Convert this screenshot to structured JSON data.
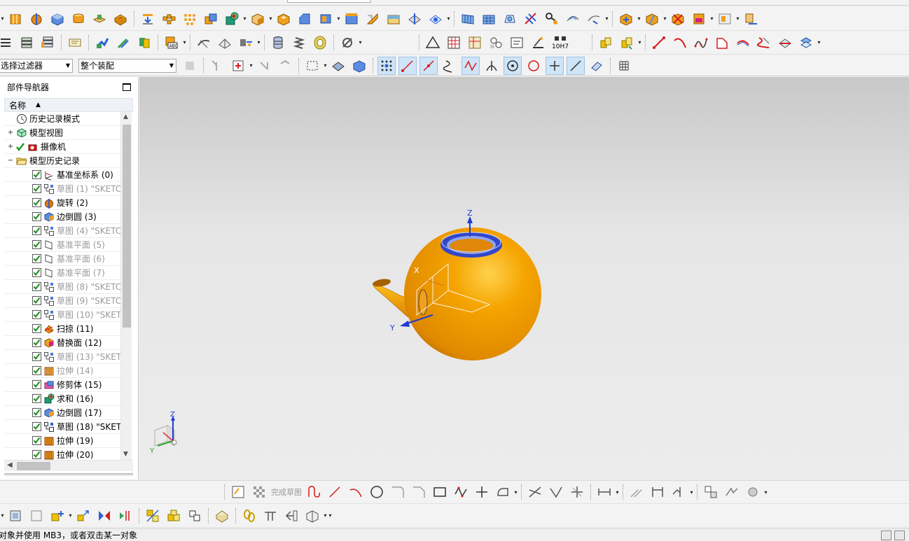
{
  "selection_bar": {
    "filter_value": "选择过滤器",
    "scope_value": "整个装配"
  },
  "navigator": {
    "title": "部件导航器",
    "column_name": "名称",
    "sort_indicator": "▲",
    "items": [
      {
        "label": "历史记录模式",
        "indent": 1,
        "icon": "clock-icon",
        "checked": null,
        "dim": false,
        "expander": ""
      },
      {
        "label": "模型视图",
        "indent": 1,
        "icon": "model-views-icon",
        "checked": null,
        "dim": false,
        "expander": "+"
      },
      {
        "label": "摄像机",
        "indent": 1,
        "icon": "camera-icon",
        "checked": "green-tick",
        "dim": false,
        "expander": "+"
      },
      {
        "label": "模型历史记录",
        "indent": 1,
        "icon": "folder-open-icon",
        "checked": null,
        "dim": false,
        "expander": "−"
      },
      {
        "label": "基准坐标系 (0)",
        "indent": 2,
        "icon": "datum-csys-icon",
        "checked": true,
        "dim": false
      },
      {
        "label": "草图 (1) \"SKETC",
        "indent": 2,
        "icon": "sketch-icon",
        "checked": true,
        "dim": true
      },
      {
        "label": "旋转 (2)",
        "indent": 2,
        "icon": "revolve-icon",
        "checked": true,
        "dim": false
      },
      {
        "label": "边倒圆 (3)",
        "indent": 2,
        "icon": "edge-blend-icon",
        "checked": true,
        "dim": false
      },
      {
        "label": "草图 (4) \"SKETC",
        "indent": 2,
        "icon": "sketch-icon",
        "checked": true,
        "dim": true
      },
      {
        "label": "基准平面 (5)",
        "indent": 2,
        "icon": "datum-plane-icon",
        "checked": true,
        "dim": true
      },
      {
        "label": "基准平面 (6)",
        "indent": 2,
        "icon": "datum-plane-icon",
        "checked": true,
        "dim": true
      },
      {
        "label": "基准平面 (7)",
        "indent": 2,
        "icon": "datum-plane-icon",
        "checked": true,
        "dim": true
      },
      {
        "label": "草图 (8) \"SKETC",
        "indent": 2,
        "icon": "sketch-icon",
        "checked": true,
        "dim": true
      },
      {
        "label": "草图 (9) \"SKETC",
        "indent": 2,
        "icon": "sketch-icon",
        "checked": true,
        "dim": true
      },
      {
        "label": "草图 (10) \"SKETC",
        "indent": 2,
        "icon": "sketch-icon",
        "checked": true,
        "dim": true
      },
      {
        "label": "扫掠 (11)",
        "indent": 2,
        "icon": "swept-icon",
        "checked": true,
        "dim": false
      },
      {
        "label": "替换面 (12)",
        "indent": 2,
        "icon": "replace-face-icon",
        "checked": true,
        "dim": false
      },
      {
        "label": "草图 (13) \"SKETC",
        "indent": 2,
        "icon": "sketch-icon",
        "checked": true,
        "dim": true
      },
      {
        "label": "拉伸 (14)",
        "indent": 2,
        "icon": "extrude-icon",
        "checked": true,
        "dim": true
      },
      {
        "label": "修剪体 (15)",
        "indent": 2,
        "icon": "trim-body-icon",
        "checked": true,
        "dim": false
      },
      {
        "label": "求和 (16)",
        "indent": 2,
        "icon": "unite-icon",
        "checked": true,
        "dim": false
      },
      {
        "label": "边倒圆 (17)",
        "indent": 2,
        "icon": "edge-blend-icon",
        "checked": true,
        "dim": false
      },
      {
        "label": "草图 (18) \"SKETC",
        "indent": 2,
        "icon": "sketch-icon",
        "checked": true,
        "dim": false
      },
      {
        "label": "拉伸 (19)",
        "indent": 2,
        "icon": "extrude-icon",
        "checked": true,
        "dim": false
      },
      {
        "label": "拉伸 (20)",
        "indent": 2,
        "icon": "extrude-icon",
        "checked": true,
        "dim": false
      }
    ]
  },
  "viewport": {
    "axis_z": "Z",
    "axis_x": "X",
    "axis_y": "Y",
    "triad_z": "Z",
    "triad_y": "Y",
    "body_color": "#f5a400",
    "rim_color": "#3347c9"
  },
  "toolbar": {
    "tolerance_label": "10H7",
    "finish_sketch_label": "完成草图"
  },
  "status": {
    "prompt": "对象并使用 MB3，或者双击某一对象"
  }
}
